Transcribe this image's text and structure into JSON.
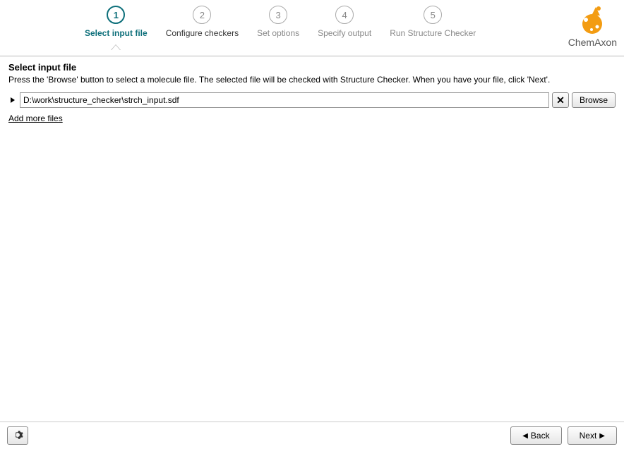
{
  "steps": [
    {
      "num": "1",
      "label": "Select input file",
      "state": "active"
    },
    {
      "num": "2",
      "label": "Configure checkers",
      "state": "normal"
    },
    {
      "num": "3",
      "label": "Set options",
      "state": "inactive"
    },
    {
      "num": "4",
      "label": "Specify output",
      "state": "inactive"
    },
    {
      "num": "5",
      "label": "Run Structure Checker",
      "state": "inactive"
    }
  ],
  "brand": "ChemAxon",
  "page": {
    "title": "Select input file",
    "description": "Press the 'Browse' button to select a molecule file. The selected file will be checked with Structure Checker. When you have your file, click 'Next'."
  },
  "file_path": "D:\\work\\structure_checker\\strch_input.sdf",
  "browse_label": "Browse",
  "add_more_label": "Add more files",
  "footer": {
    "back_label": "Back",
    "next_label": "Next"
  }
}
